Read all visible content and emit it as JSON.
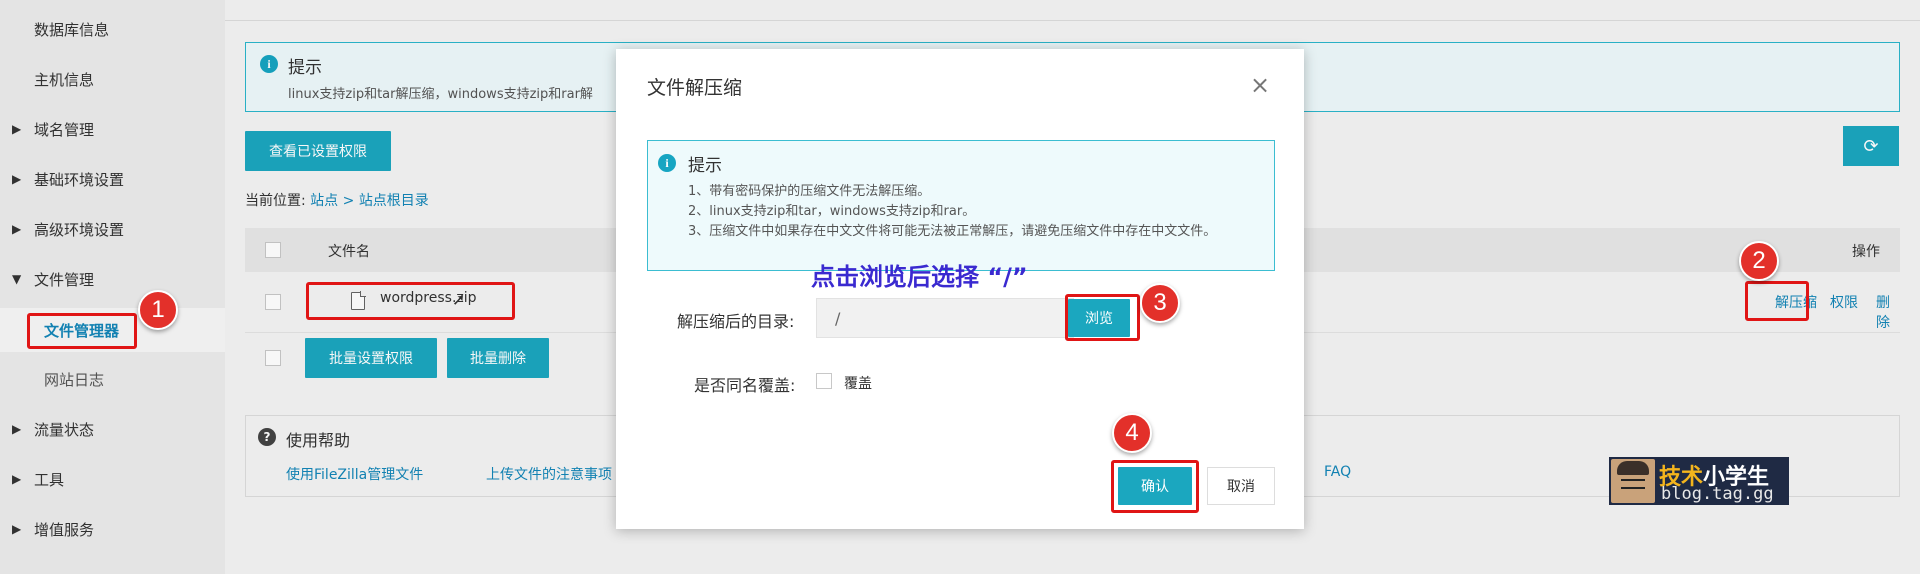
{
  "sidebar": {
    "items": [
      {
        "label": "数据库信息",
        "arrow": ""
      },
      {
        "label": "主机信息",
        "arrow": ""
      },
      {
        "label": "域名管理",
        "arrow": "▶"
      },
      {
        "label": "基础环境设置",
        "arrow": "▶"
      },
      {
        "label": "高级环境设置",
        "arrow": "▶"
      },
      {
        "label": "文件管理",
        "arrow": "▼"
      },
      {
        "label": "文件管理器",
        "arrow": ""
      },
      {
        "label": "网站日志",
        "arrow": ""
      },
      {
        "label": "流量状态",
        "arrow": "▶"
      },
      {
        "label": "工具",
        "arrow": "▶"
      },
      {
        "label": "增值服务",
        "arrow": "▶"
      }
    ]
  },
  "main": {
    "tip": {
      "title": "提示",
      "text": "linux支持zip和tar解压缩，windows支持zip和rar解"
    },
    "view_permissions_button": "查看已设置权限",
    "refresh_icon": "⟳",
    "breadcrumb": {
      "prefix": "当前位置:",
      "items": [
        "站点",
        "站点根目录"
      ],
      "separator": ">"
    },
    "table": {
      "col_name": "文件名",
      "col_ops": "操作",
      "rows": [
        {
          "name": "wordpress.zip",
          "ops": [
            "解压缩",
            "权限",
            "删除"
          ]
        }
      ]
    },
    "batch_permissions_button": "批量设置权限",
    "batch_delete_button": "批量删除",
    "help": {
      "title": "使用帮助",
      "links": [
        "使用FileZilla管理文件",
        "上传文件的注意事项",
        "FAQ"
      ]
    }
  },
  "dialog": {
    "title": "文件解压缩",
    "close_icon": "×",
    "tip": {
      "title": "提示",
      "lines": [
        "1、带有密码保护的压缩文件无法解压缩。",
        "2、linux支持zip和tar，windows支持zip和rar。",
        "3、压缩文件中如果存在中文文件将可能无法被正常解压，请避免压缩文件中存在中文文件。"
      ]
    },
    "dir_label": "解压缩后的目录:",
    "dir_value": "/",
    "browse_button": "浏览",
    "overwrite_label": "是否同名覆盖:",
    "overwrite_checkbox_label": "覆盖",
    "confirm_button": "确认",
    "cancel_button": "取消"
  },
  "annotations": {
    "instruction": "点击浏览后选择 “/”",
    "badges": [
      "1",
      "2",
      "3",
      "4"
    ],
    "color": "#e01515"
  },
  "watermark": {
    "title_a": "技术",
    "title_b": "小学生",
    "url": "blog.tag.gg"
  }
}
